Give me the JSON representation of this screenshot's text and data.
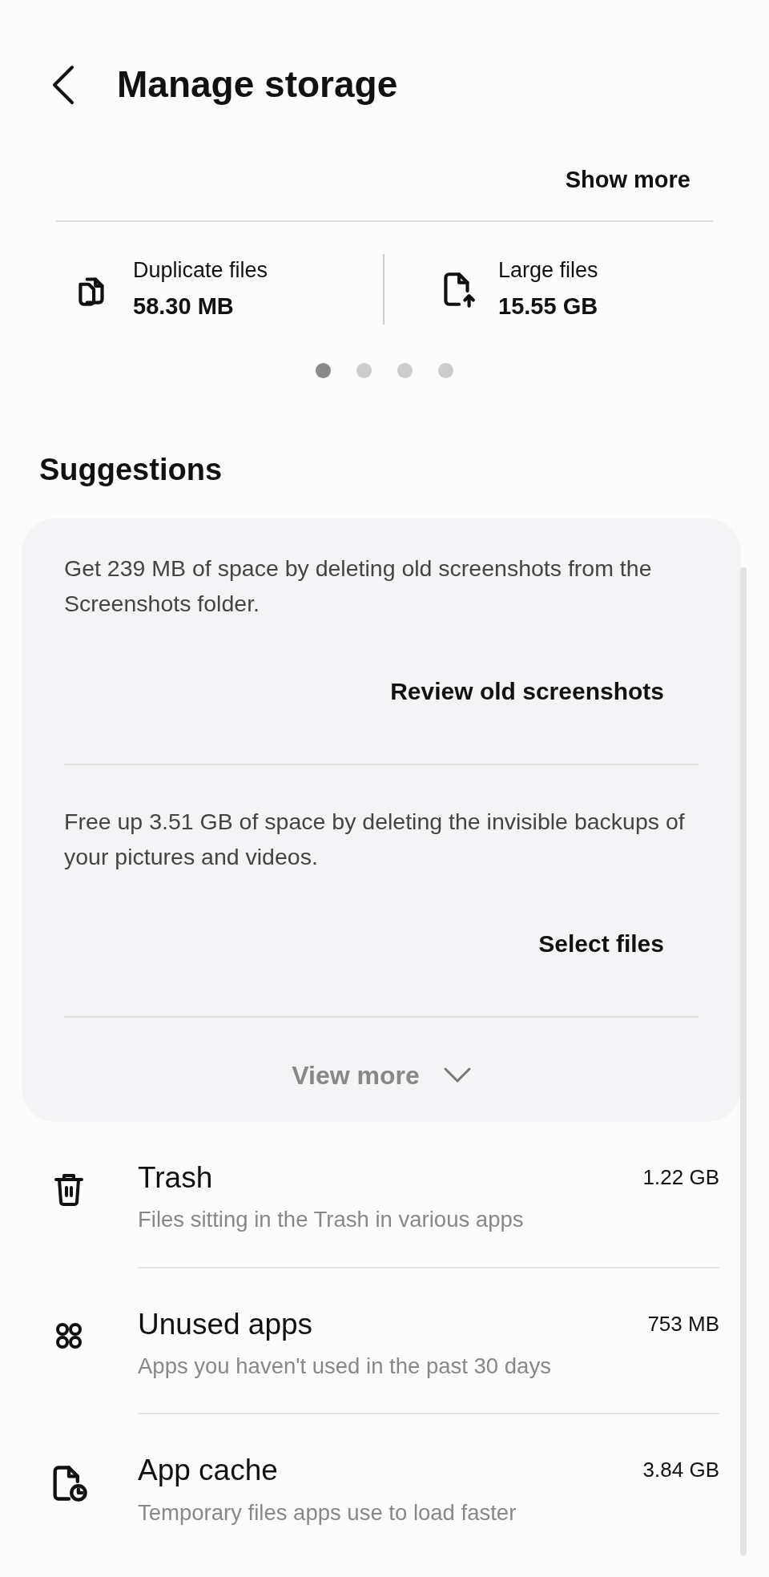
{
  "header": {
    "title": "Manage storage"
  },
  "show_more": "Show more",
  "stats": [
    {
      "label": "Duplicate files",
      "value": "58.30 MB"
    },
    {
      "label": "Large files",
      "value": "15.55 GB"
    }
  ],
  "pages": [
    {
      "selected": true
    },
    {
      "selected": false
    },
    {
      "selected": false
    },
    {
      "selected": false
    }
  ],
  "suggestions": {
    "heading": "Suggestions",
    "items": [
      {
        "text": "Get 239 MB of space by deleting old screenshots from the Screenshots folder.",
        "action": "Review old screenshots"
      },
      {
        "text": "Free up 3.51 GB of space by deleting the invisible backups of your pictures and videos.",
        "action": "Select files"
      }
    ],
    "view_more": "View more"
  },
  "list": [
    {
      "title": "Trash",
      "subtitle": "Files sitting in the Trash in various apps",
      "size": "1.22 GB"
    },
    {
      "title": "Unused apps",
      "subtitle": "Apps you haven't used in the past 30 days",
      "size": "753 MB"
    },
    {
      "title": "App cache",
      "subtitle": "Temporary files apps use to load faster",
      "size": "3.84 GB"
    }
  ]
}
